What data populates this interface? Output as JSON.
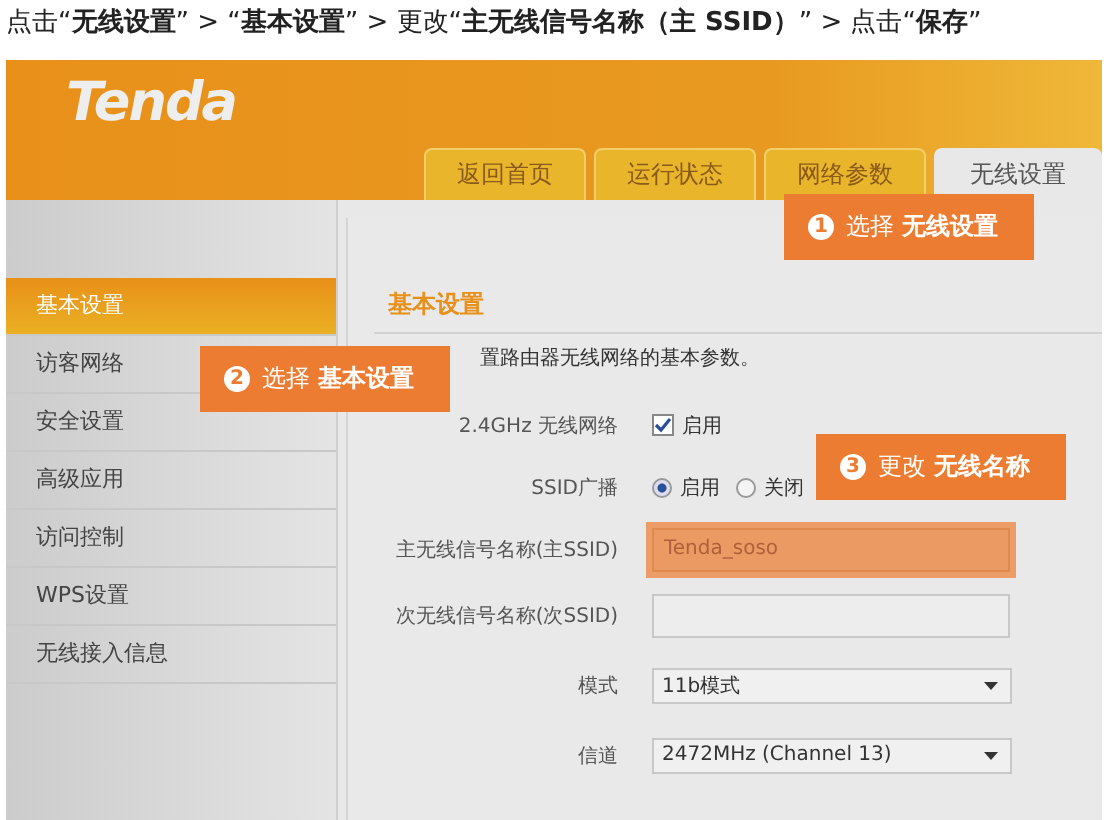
{
  "instruction": "点击“**无线设置**” > “**基本设置**” > 更改“**主无线信号名称（主 SSID）**” > 点击“**保存**”",
  "logo": "Tenda",
  "tabs": [
    {
      "label": "返回首页",
      "selected": false
    },
    {
      "label": "运行状态",
      "selected": false
    },
    {
      "label": "网络参数",
      "selected": false
    },
    {
      "label": "无线设置",
      "selected": true
    }
  ],
  "sidebar": {
    "items": [
      {
        "label": "基本设置",
        "selected": true
      },
      {
        "label": "访客网络",
        "selected": false
      },
      {
        "label": "安全设置",
        "selected": false
      },
      {
        "label": "高级应用",
        "selected": false
      },
      {
        "label": "访问控制",
        "selected": false
      },
      {
        "label": "WPS设置",
        "selected": false
      },
      {
        "label": "无线接入信息",
        "selected": false
      }
    ]
  },
  "content": {
    "title": "基本设置",
    "description": "置路由器无线网络的基本参数。",
    "rows": [
      {
        "kind": "checkbox",
        "label": "2.4GHz 无线网络",
        "checked": true,
        "option": "启用"
      },
      {
        "kind": "radio",
        "label": "SSID广播",
        "options": [
          {
            "label": "启用",
            "selected": true
          },
          {
            "label": "关闭",
            "selected": false
          }
        ]
      },
      {
        "kind": "text",
        "label": "主无线信号名称(主SSID)",
        "value": "Tenda_soso",
        "highlighted": true
      },
      {
        "kind": "text",
        "label": "次无线信号名称(次SSID)",
        "highlighted": false
      },
      {
        "kind": "select",
        "label": "模式",
        "value": "11b模式"
      },
      {
        "kind": "select",
        "label": "信道",
        "value": "2472MHz (Channel 13)"
      }
    ]
  },
  "callouts": [
    {
      "number": "1",
      "text": "选择 **无线设置**"
    },
    {
      "number": "2",
      "text": "选择 **基本设置**"
    },
    {
      "number": "3",
      "text": "更改 **无线名称**"
    }
  ]
}
